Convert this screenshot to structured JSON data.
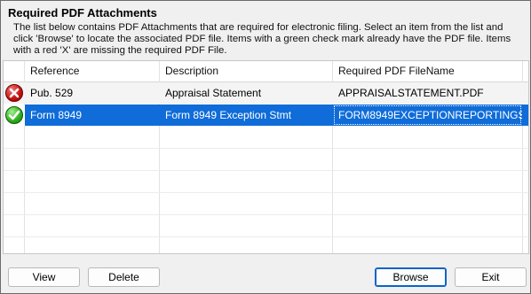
{
  "dialog": {
    "title": "Required PDF Attachments",
    "description": "The list below contains PDF Attachments that are required for electronic filing. Select an item from the list and click 'Browse' to locate the associated PDF file. Items with a green check mark already have the PDF file. Items with a red 'X' are missing the required PDF File."
  },
  "grid": {
    "columns": [
      "Reference",
      "Description",
      "Required PDF FileName"
    ],
    "rows": [
      {
        "status_icon": "red-x-icon",
        "reference": "Pub. 529",
        "description": "Appraisal Statement",
        "filename": "APPRAISALSTATEMENT.PDF",
        "selected": false
      },
      {
        "status_icon": "green-check-icon",
        "reference": "Form 8949",
        "description": "Form 8949 Exception Stmt",
        "filename": "FORM8949EXCEPTIONREPORTINGS...",
        "selected": true
      }
    ]
  },
  "colors": {
    "selection": "#0f6cd9",
    "missing_icon": "#c21010",
    "present_icon": "#2fae1e"
  },
  "buttons": {
    "view": "View",
    "delete": "Delete",
    "browse": "Browse",
    "exit": "Exit"
  }
}
